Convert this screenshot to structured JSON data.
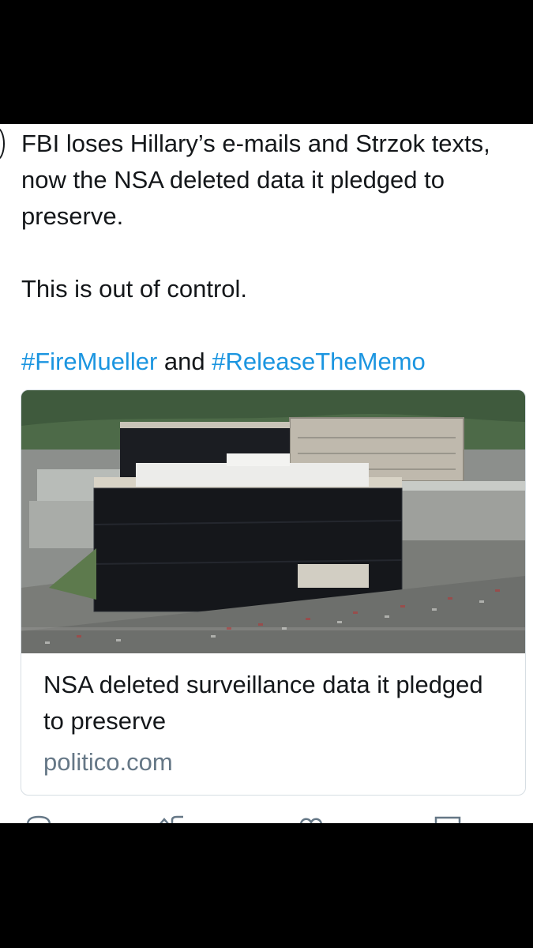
{
  "tweet": {
    "line1": "FBI loses Hillary’s e-mails and Strzok texts, now the NSA deleted data it pledged to preserve.",
    "line2": "This is out of control.",
    "hashtag1": "#FireMueller",
    "connector": "and",
    "hashtag2": "#ReleaseTheMemo"
  },
  "card": {
    "title": "NSA deleted surveillance data it pledged to preserve",
    "domain": "politico.com",
    "image_icon": "nsa-headquarters-photo"
  },
  "actions": {
    "icons": [
      "reply-icon",
      "retweet-icon",
      "like-icon",
      "share-icon"
    ]
  },
  "colors": {
    "hashtag": "#1b95e0",
    "text": "#14171a",
    "secondary": "#657786",
    "border": "#d7dee3"
  }
}
